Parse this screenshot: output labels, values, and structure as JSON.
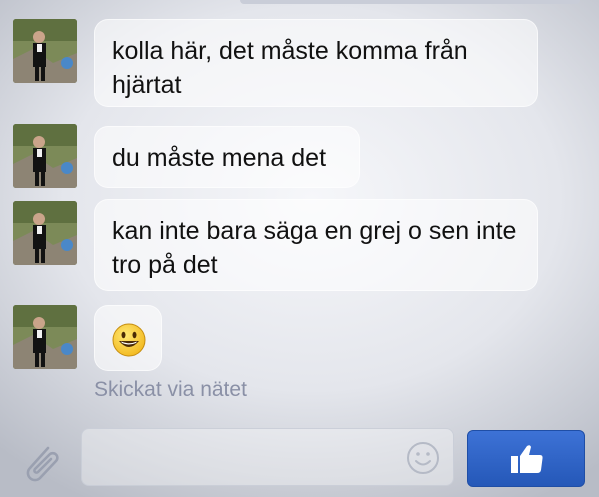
{
  "messages": [
    {
      "text": "kolla här, det måste komma från hjärtat"
    },
    {
      "text": "du måste mena det"
    },
    {
      "text": "kan inte bara säga en grej o sen inte tro på det"
    },
    {
      "text": "😀"
    }
  ],
  "status": "Skickat via nätet",
  "composer": {
    "input_value": "",
    "attach_icon": "paperclip-icon",
    "emoji_icon": "smiley-icon",
    "like_icon": "thumbs-up-icon"
  },
  "colors": {
    "like_button": "#2f64c8",
    "status_text": "#8a90a6"
  }
}
